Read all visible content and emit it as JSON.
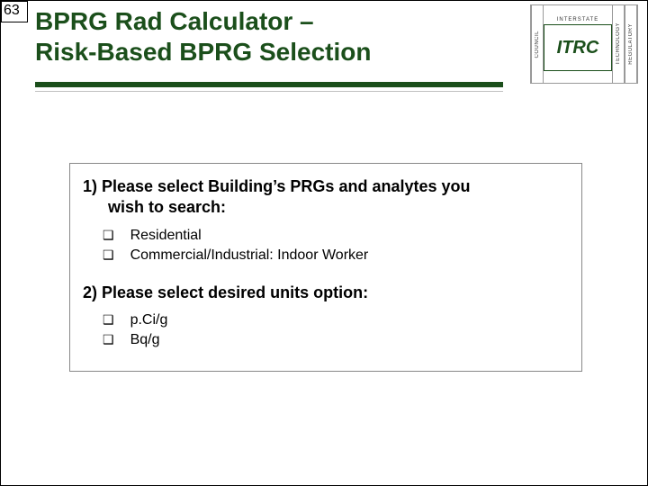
{
  "page_number": "63",
  "title_line1": "BPRG Rad Calculator –",
  "title_line2": "Risk-Based BPRG Selection",
  "itrc": {
    "left_label": "COUNCIL",
    "top_label": "INTERSTATE",
    "right_top": "TECHNOLOGY",
    "right_bottom": "REGULATORY",
    "logo_text": "ITRC"
  },
  "section1": {
    "heading_lead": "1) Please select Building’s PRGs and analytes you",
    "heading_cont": "wish to search:",
    "options": [
      "Residential",
      "Commercial/Industrial: Indoor Worker"
    ]
  },
  "section2": {
    "heading": "2)  Please select desired units option:",
    "options": [
      "p.Ci/g",
      "Bq/g"
    ]
  },
  "checkbox_glyph": "❑"
}
